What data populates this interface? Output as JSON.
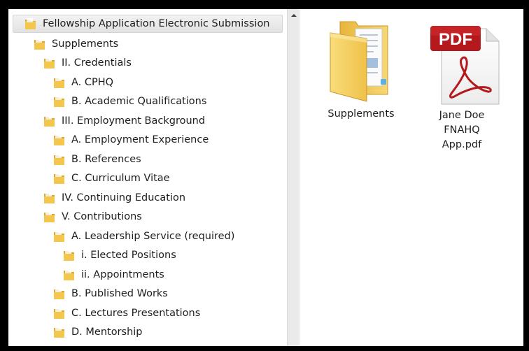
{
  "tree": {
    "items": [
      {
        "label": "Fellowship Application Electronic Submission",
        "level": 0,
        "selected": true
      },
      {
        "label": "Supplements",
        "level": 1
      },
      {
        "label": "II. Credentials",
        "level": 2
      },
      {
        "label": "A. CPHQ",
        "level": 3
      },
      {
        "label": "B. Academic Qualifications",
        "level": 3
      },
      {
        "label": "III. Employment Background",
        "level": 2
      },
      {
        "label": "A. Employment Experience",
        "level": 3
      },
      {
        "label": "B. References",
        "level": 3
      },
      {
        "label": "C. Curriculum Vitae",
        "level": 3
      },
      {
        "label": "IV. Continuing Education",
        "level": 2
      },
      {
        "label": "V. Contributions",
        "level": 2
      },
      {
        "label": "A. Leadership Service (required)",
        "level": 3
      },
      {
        "label": "i. Elected Positions",
        "level": 4
      },
      {
        "label": "ii. Appointments",
        "level": 4
      },
      {
        "label": "B. Published Works",
        "level": 3
      },
      {
        "label": "C. Lectures Presentations",
        "level": 3
      },
      {
        "label": "D. Mentorship",
        "level": 3
      }
    ]
  },
  "content": {
    "files": [
      {
        "label": "Supplements",
        "icon": "folder-icon"
      },
      {
        "label": "Jane Doe FNAHQ App.pdf",
        "icon": "pdf-icon",
        "badge": "PDF"
      }
    ]
  },
  "colors": {
    "folder": "#f3c64e",
    "pdf_red": "#b3191d"
  }
}
